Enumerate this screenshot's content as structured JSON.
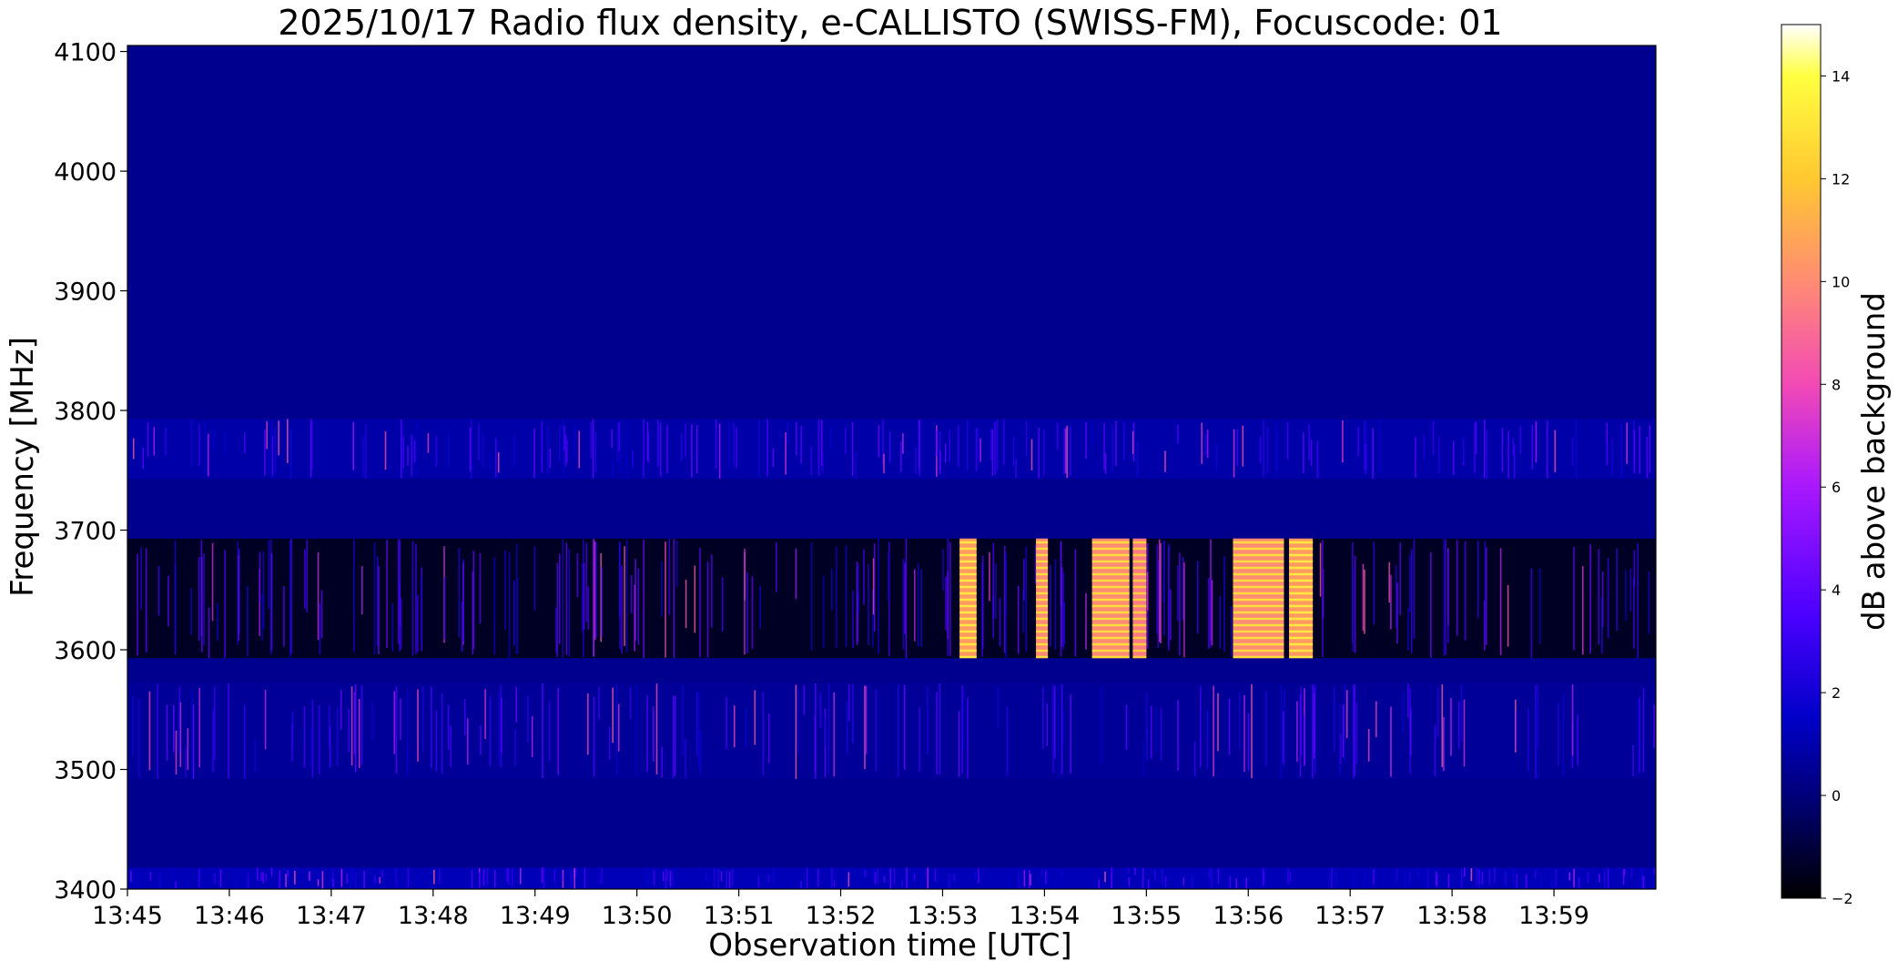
{
  "chart_data": {
    "type": "heatmap",
    "title": "2025/10/17  Radio flux density, e-CALLISTO (SWISS-FM), Focuscode: 01",
    "xlabel": "Observation time [UTC]",
    "ylabel": "Frequency [MHz]",
    "colorbar_label": "dB above background",
    "x_tick_labels": [
      "13:45",
      "13:46",
      "13:47",
      "13:48",
      "13:49",
      "13:50",
      "13:51",
      "13:52",
      "13:53",
      "13:54",
      "13:55",
      "13:56",
      "13:57",
      "13:58",
      "13:59"
    ],
    "xlim": [
      "13:45:00",
      "14:00:00"
    ],
    "y_ticks": [
      3400,
      3500,
      3600,
      3700,
      3800,
      3900,
      4000,
      4100
    ],
    "ylim": [
      3400,
      4105
    ],
    "colorbar_ticks": [
      -2,
      0,
      2,
      4,
      6,
      8,
      10,
      12,
      14
    ],
    "colorbar_range": [
      -2,
      15
    ],
    "colormap": "gnuplot2",
    "colormap_stops": [
      {
        "v": -2,
        "color": "#000000"
      },
      {
        "v": 0,
        "color": "#00007a"
      },
      {
        "v": 1.5,
        "color": "#0000c8"
      },
      {
        "v": 3.5,
        "color": "#4a00ff"
      },
      {
        "v": 6,
        "color": "#a818ff"
      },
      {
        "v": 8,
        "color": "#f24ab5"
      },
      {
        "v": 10,
        "color": "#ff8c73"
      },
      {
        "v": 12,
        "color": "#ffc830"
      },
      {
        "v": 14,
        "color": "#ffff40"
      },
      {
        "v": 15,
        "color": "#ffffff"
      }
    ],
    "background_level_dB": 0.4,
    "frequency_bands": [
      {
        "f_start": 3400,
        "f_end": 3418,
        "description": "noisy band",
        "level_dB": 1.2
      },
      {
        "f_start": 3418,
        "f_end": 3492,
        "description": "quiet band",
        "level_dB": 0.4
      },
      {
        "f_start": 3492,
        "f_end": 3572,
        "description": "noisy band with interference streaks",
        "level_dB": 0.6
      },
      {
        "f_start": 3572,
        "f_end": 3593,
        "description": "quiet band",
        "level_dB": 0.4
      },
      {
        "f_start": 3593,
        "f_end": 3693,
        "description": "dark band with spiky bursts",
        "level_dB": -1.4
      },
      {
        "f_start": 3693,
        "f_end": 3743,
        "description": "quiet band",
        "level_dB": 0.4
      },
      {
        "f_start": 3743,
        "f_end": 3793,
        "description": "noisy band",
        "level_dB": 0.9
      },
      {
        "f_start": 3793,
        "f_end": 4105,
        "description": "quiet band",
        "level_dB": 0.4
      }
    ],
    "bursts": [
      {
        "f_start": 3593,
        "f_end": 3693,
        "t_start": "13:53:10",
        "t_end": "13:53:20",
        "peak_dB": 13.5
      },
      {
        "f_start": 3593,
        "f_end": 3693,
        "t_start": "13:53:55",
        "t_end": "13:54:02",
        "peak_dB": 13.0
      },
      {
        "f_start": 3593,
        "f_end": 3693,
        "t_start": "13:54:28",
        "t_end": "13:54:50",
        "peak_dB": 13.0
      },
      {
        "f_start": 3593,
        "f_end": 3693,
        "t_start": "13:54:52",
        "t_end": "13:55:00",
        "peak_dB": 12.5
      },
      {
        "f_start": 3593,
        "f_end": 3693,
        "t_start": "13:55:51",
        "t_end": "13:56:21",
        "peak_dB": 13.0
      },
      {
        "f_start": 3593,
        "f_end": 3693,
        "t_start": "13:56:24",
        "t_end": "13:56:38",
        "peak_dB": 13.5
      }
    ],
    "grid": false
  }
}
